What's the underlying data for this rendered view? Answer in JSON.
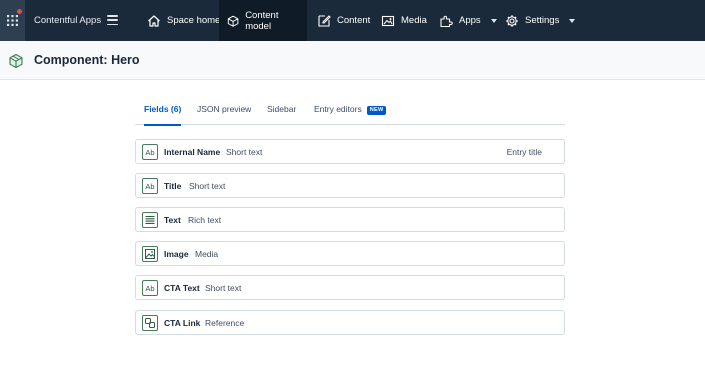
{
  "nav": {
    "app_title": "Contentful Apps",
    "items": [
      {
        "label": "Space home",
        "icon": "home-icon"
      },
      {
        "label": "Content model",
        "icon": "cube-icon"
      },
      {
        "label": "Content",
        "icon": "edit-icon"
      },
      {
        "label": "Media",
        "icon": "media-icon"
      },
      {
        "label": "Apps",
        "icon": "puzzle-icon"
      },
      {
        "label": "Settings",
        "icon": "gear-icon"
      }
    ]
  },
  "header": {
    "title": "Component: Hero"
  },
  "tabs": [
    {
      "label": "Fields (6)"
    },
    {
      "label": "JSON preview"
    },
    {
      "label": "Sidebar"
    },
    {
      "label": "Entry editors",
      "badge": "NEW"
    }
  ],
  "fields": [
    {
      "name": "Internal Name",
      "type": "Short text",
      "icon": "Ab",
      "extra": "Entry title"
    },
    {
      "name": "Title",
      "type": "Short text",
      "icon": "Ab"
    },
    {
      "name": "Text",
      "type": "Rich text",
      "icon": "rich-text-icon"
    },
    {
      "name": "Image",
      "type": "Media",
      "icon": "image-icon"
    },
    {
      "name": "CTA Text",
      "type": "Short text",
      "icon": "Ab"
    },
    {
      "name": "CTA Link",
      "type": "Reference",
      "icon": "reference-icon"
    }
  ],
  "colors": {
    "nav_bg": "#1b2a3a",
    "accent": "#0059c8",
    "field_icon": "#4a7a5c"
  }
}
